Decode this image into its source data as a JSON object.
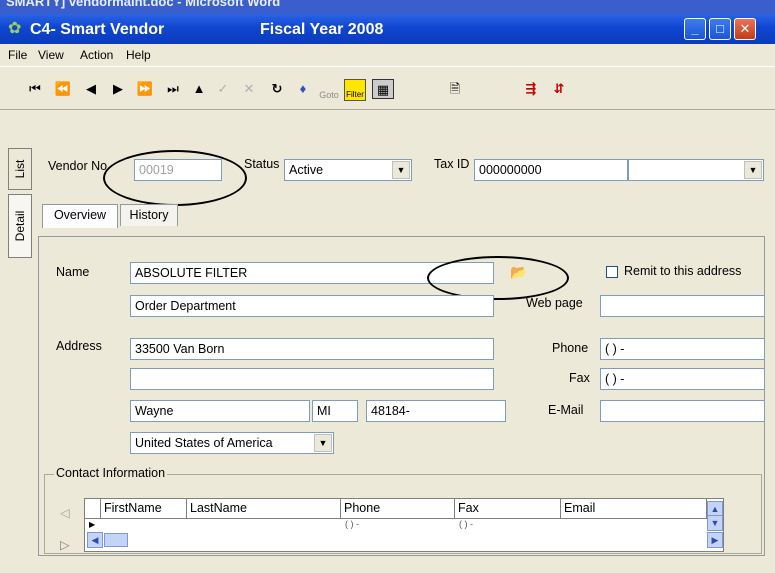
{
  "word_window_title": "SMARTY] vendormaint.doc - Microsoft Word",
  "app": {
    "title": "C4- Smart Vendor",
    "fiscal": "Fiscal Year 2008",
    "minimize": "_",
    "maximize": "□",
    "close": "✕"
  },
  "menu": [
    "File",
    "View",
    "Action",
    "Help"
  ],
  "toolbar": {
    "goto_label": "Goto",
    "filter_label": "Filter"
  },
  "side_tabs": {
    "list": "List",
    "detail": "Detail"
  },
  "header": {
    "vendor_no_label": "Vendor No",
    "vendor_no_value": "00019",
    "status_label": "Status",
    "status_value": "Active",
    "tax_id_label": "Tax ID",
    "tax_id_value": "000000000",
    "tax_type_value": ""
  },
  "tabs": [
    "Overview",
    "History"
  ],
  "form": {
    "name_label": "Name",
    "name_value": "ABSOLUTE FILTER",
    "name2_value": "Order Department",
    "remit_label": "Remit to this address",
    "remit_checked": false,
    "web_label": "Web page",
    "web_value": "",
    "address_label": "Address",
    "address1": "33500 Van Born",
    "address2": "",
    "city": "Wayne",
    "state": "MI",
    "zip": "48184-",
    "country": "United States of America",
    "phone_label": "Phone",
    "phone_value": "(   )    -",
    "fax_label": "Fax",
    "fax_value": "(   )    -",
    "email_label": "E-Mail",
    "email_value": ""
  },
  "contacts": {
    "legend": "Contact Information",
    "columns": [
      "FirstName",
      "LastName",
      "Phone",
      "Fax",
      "Email"
    ],
    "row_phone": "(  )  -",
    "row_fax": "(  )  -"
  }
}
